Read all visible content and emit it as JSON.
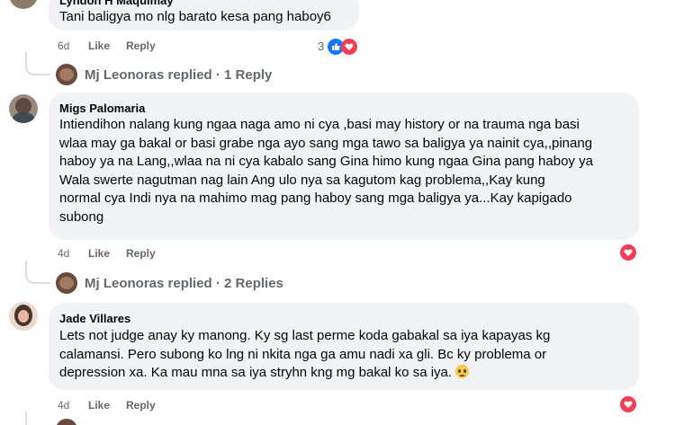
{
  "comment_top": {
    "author": "Lyndon H Maquimay",
    "text": "Tani baligya mo nlg barato kesa pang haboy6",
    "time": "6d",
    "like_label": "Like",
    "reply_label": "Reply",
    "reaction_count": "3",
    "reactions": [
      "like-icon",
      "heart-icon"
    ],
    "replies_summary": "Mj Leonoras replied · 1 Reply"
  },
  "comment_migs": {
    "author": "Migs Palomaria",
    "lines": [
      "Intiendihon nalang kung ngaa naga amo ni cya ,basi may history or na trauma nga basi",
      "wlaa may ga bakal or basi grabe nga ayo sang mga tawo sa baligya ya nainit cya,,pinang",
      "haboy ya na Lang,,wlaa na ni cya kabalo sang Gina himo kung ngaa Gina pang haboy ya",
      "Wala swerte nagutman nag lain Ang ulo nya sa kagutom kag problema,,Kay kung",
      "normal cya Indi nya na mahimo mag pang haboy sang mga baligya ya...Kay kapigado",
      "subong"
    ],
    "time": "4d",
    "like_label": "Like",
    "reply_label": "Reply",
    "reactions": [
      "heart-icon"
    ],
    "replies_summary": "Mj Leonoras replied · 2 Replies"
  },
  "comment_jade": {
    "author": "Jade Villares",
    "lines": [
      "Lets not judge anay ky manong. Ky sg last perme koda gabakal sa iya kapayas kg",
      "calamansi. Pero subong ko lng ni nkita nga ga amu nadi xa gli. Bc ky problema or",
      "depression xa. Ka mau mna sa iya stryhn kng mg bakal ko sa iya."
    ],
    "time": "4d",
    "like_label": "Like",
    "reply_label": "Reply",
    "reactions": [
      "heart-icon"
    ]
  },
  "colors": {
    "bubble": "#f0f2f5",
    "meta_text": "#65676b",
    "like_blue": "#1877f2",
    "heart_red": "#f33e58"
  }
}
